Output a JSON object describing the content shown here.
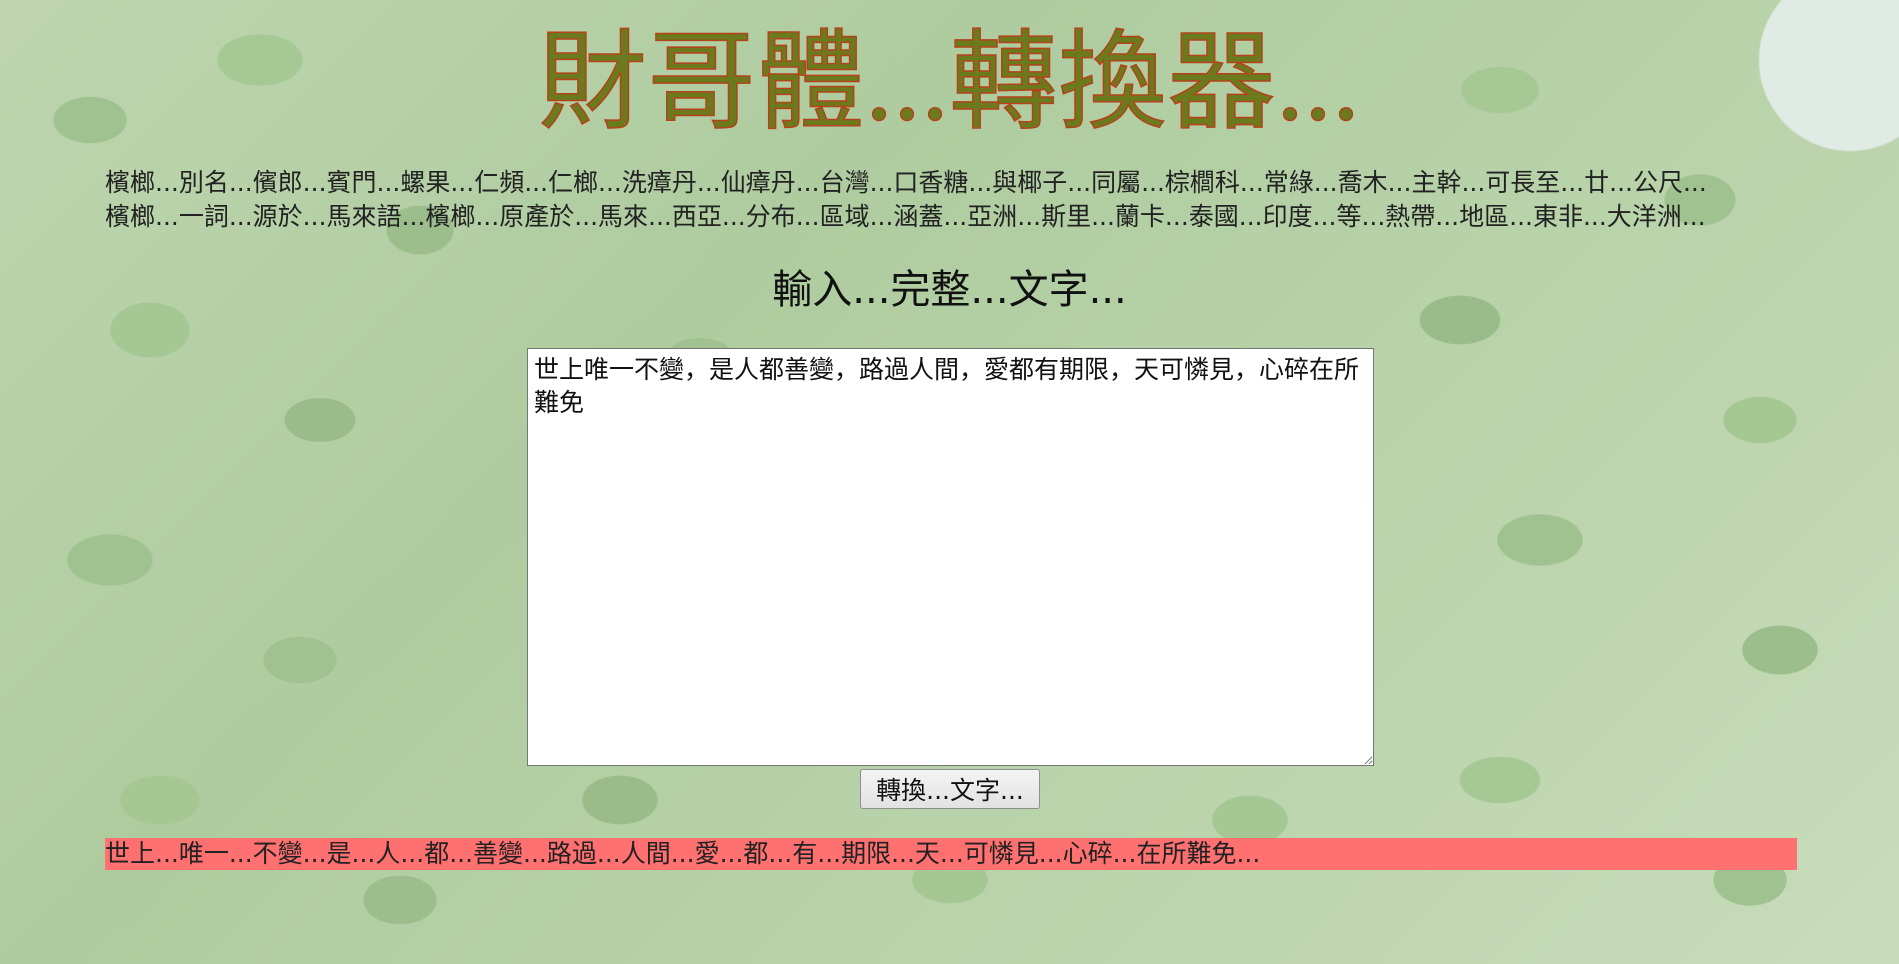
{
  "header": {
    "title": "財哥體...轉換器..."
  },
  "intro": {
    "line1": "檳榔...別名...儐郎...賓門...螺果...仁頻...仁榔...洗瘴丹...仙瘴丹...台灣...口香糖...與椰子...同屬...棕櫚科...常綠...喬木...主幹...可長至...廿...公尺...",
    "line2": "檳榔...一詞...源於...馬來語...檳榔...原產於...馬來...西亞...分布...區域...涵蓋...亞洲...斯里...蘭卡...泰國...印度...等...熱帶...地區...東非...大洋洲..."
  },
  "form": {
    "heading": "輸入...完整...文字...",
    "input_value": "世上唯一不變，是人都善變，路過人間，愛都有期限，天可憐見，心碎在所難免",
    "button_label": "轉換...文字..."
  },
  "result": {
    "text": "世上...唯一...不變...是...人...都...善變...路過...人間...愛...都...有...期限...天...可憐見...心碎...在所難免..."
  },
  "colors": {
    "title_fill": "#6b7a1c",
    "title_stroke": "#b5421a",
    "result_background": "#ff7070"
  }
}
